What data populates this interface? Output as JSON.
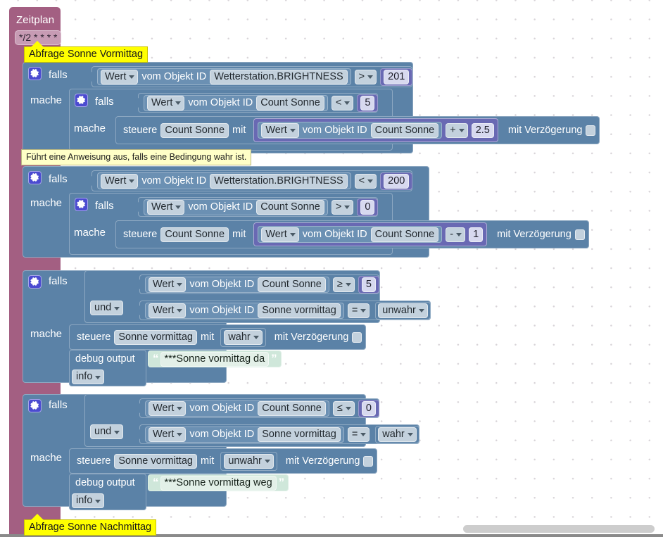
{
  "workspace": {
    "scrollbar_name": "horizontal-scrollbar"
  },
  "schedule": {
    "title": "Zeitplan",
    "cron": "*/2 * * * *"
  },
  "comments": {
    "top": "Abfrage Sonne Vormittag",
    "bottom": "Abfrage Sonne Nachmittag"
  },
  "tooltip": {
    "text": "Führt eine Anweisung aus, falls eine Bedingung wahr ist."
  },
  "keywords": {
    "if": "falls",
    "do": "mache",
    "and": "und",
    "set": "steuere",
    "with": "mit",
    "get_value": "Wert",
    "from_object_id": "vom Objekt ID",
    "delay": "mit Verzögerung",
    "debug_output": "debug output",
    "gear_icon": "gear-icon"
  },
  "group1": {
    "cond": {
      "value_field": "Wert",
      "prefix": "vom Objekt ID",
      "object_id": "Wetterstation.BRIGHTNESS",
      "operator": ">",
      "number": "201"
    },
    "inner_cond": {
      "value_field": "Wert",
      "prefix": "vom Objekt ID",
      "object_id": "Count Sonne",
      "operator": "<",
      "number": "5"
    },
    "action": {
      "set": "steuere",
      "target": "Count Sonne",
      "with": "mit",
      "value_field": "Wert",
      "prefix": "vom Objekt ID",
      "object_id": "Count Sonne",
      "operator": "+",
      "number": "2.5",
      "delay": "mit Verzögerung"
    }
  },
  "group2": {
    "cond": {
      "value_field": "Wert",
      "prefix": "vom Objekt ID",
      "object_id": "Wetterstation.BRIGHTNESS",
      "operator": "<",
      "number": "200"
    },
    "inner_cond": {
      "value_field": "Wert",
      "prefix": "vom Objekt ID",
      "object_id": "Count Sonne",
      "operator": ">",
      "number": "0"
    },
    "action": {
      "set": "steuere",
      "target": "Count Sonne",
      "with": "mit",
      "value_field": "Wert",
      "prefix": "vom Objekt ID",
      "object_id": "Count Sonne",
      "operator": "-",
      "number": "1",
      "delay": "mit Verzögerung"
    }
  },
  "group3": {
    "cond_a": {
      "value_field": "Wert",
      "prefix": "vom Objekt ID",
      "object_id": "Count Sonne",
      "operator": "≥",
      "number": "5"
    },
    "logic_op": "und",
    "cond_b": {
      "value_field": "Wert",
      "prefix": "vom Objekt ID",
      "object_id": "Sonne vormittag",
      "operator": "=",
      "bool": "unwahr"
    },
    "action": {
      "set": "steuere",
      "target": "Sonne vormittag",
      "with": "mit",
      "bool": "wahr",
      "delay": "mit Verzögerung"
    },
    "debug": {
      "label": "debug output",
      "text": "***Sonne vormittag da",
      "level": "info"
    }
  },
  "group4": {
    "cond_a": {
      "value_field": "Wert",
      "prefix": "vom Objekt ID",
      "object_id": "Count Sonne",
      "operator": "≤",
      "number": "0"
    },
    "logic_op": "und",
    "cond_b": {
      "value_field": "Wert",
      "prefix": "vom Objekt ID",
      "object_id": "Sonne vormittag",
      "operator": "=",
      "bool": "wahr"
    },
    "action": {
      "set": "steuere",
      "target": "Sonne vormittag",
      "with": "mit",
      "bool": "unwahr",
      "delay": "mit Verzögerung"
    },
    "debug": {
      "label": "debug output",
      "text": "***Sonne vormittag weg",
      "level": "info"
    }
  },
  "colors": {
    "schedule": "#a35f82",
    "control": "#5b82a7",
    "math": "#6969b3",
    "text": "#cfe7da",
    "comment": "#ffff00",
    "tooltip": "#ffffc7"
  }
}
